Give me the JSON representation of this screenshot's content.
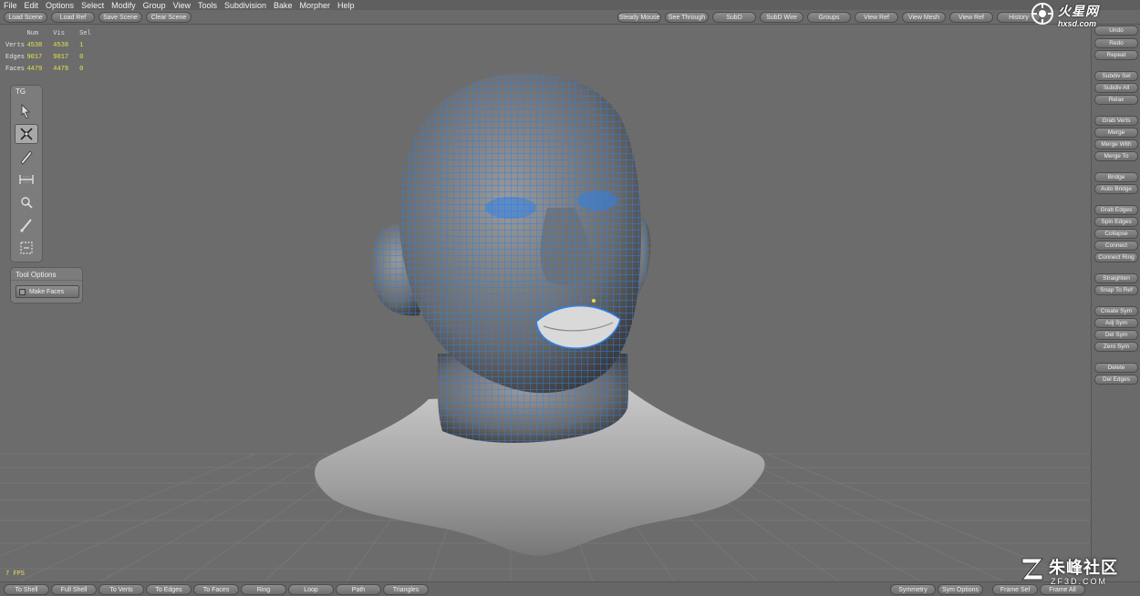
{
  "menu": [
    "File",
    "Edit",
    "Options",
    "Select",
    "Modify",
    "Group",
    "View",
    "Tools",
    "Subdivision",
    "Bake",
    "Morpher",
    "Help"
  ],
  "top_left_buttons": [
    "Load Scene",
    "Load Ref",
    "Save Scene",
    "Clear Scene"
  ],
  "top_right_buttons": [
    "Steady Mouse",
    "See Through",
    "SubD",
    "SubD Wire",
    "Groups",
    "View Ref",
    "View Mesh",
    "View Ref",
    "History"
  ],
  "stats": {
    "headers": [
      "Num",
      "Vis",
      "Sel"
    ],
    "rows": [
      {
        "label": "Verts",
        "num": "4538",
        "vis": "4538",
        "sel": "1"
      },
      {
        "label": "Edges",
        "num": "9017",
        "vis": "9017",
        "sel": "0"
      },
      {
        "label": "Faces",
        "num": "4479",
        "vis": "4479",
        "sel": "0"
      }
    ]
  },
  "tg_panel": {
    "title": "TG",
    "tools": [
      "select-arrow-icon",
      "tweak-cross-icon",
      "pencil-icon",
      "extrude-edge-icon",
      "drag-loop-icon",
      "brush-icon",
      "extend-icon"
    ],
    "active_index": 1
  },
  "tool_options": {
    "title": "Tool Options",
    "make_faces": "Make Faces"
  },
  "right_buttons": [
    "Undo",
    "Redo",
    "Repeat",
    "Subdiv Sel",
    "Subdiv All",
    "Relax",
    "Grab Verts",
    "Merge",
    "Merge With",
    "Merge To",
    "Bridge",
    "Auto Bridge",
    "Grab Edges",
    "Spin Edges",
    "Collapse",
    "Connect",
    "Connect Ring",
    "Straighten",
    "Snap To Ref",
    "Create Sym",
    "Adj Sym",
    "Del Sym",
    "Zero Sym",
    "Delete",
    "Del Edges"
  ],
  "bottom_left_buttons": [
    "To Shell",
    "Full Shell",
    "To Verts",
    "To Edges",
    "To Faces",
    "Ring",
    "Loop",
    "Path",
    "Triangles"
  ],
  "bottom_right_buttons": [
    "Symmetry",
    "Sym Options",
    "Frame Sel",
    "Frame All"
  ],
  "fps": "7 FPS",
  "watermark_top": {
    "line1": "火星网",
    "line2": "hxsd.com"
  },
  "watermark_bottom": {
    "line1": "朱峰社区",
    "line2": "ZF3D.COM"
  },
  "colors": {
    "wire": "#2f7fe8",
    "stat_value": "#e6e24a",
    "background": "#6b6b6b"
  }
}
